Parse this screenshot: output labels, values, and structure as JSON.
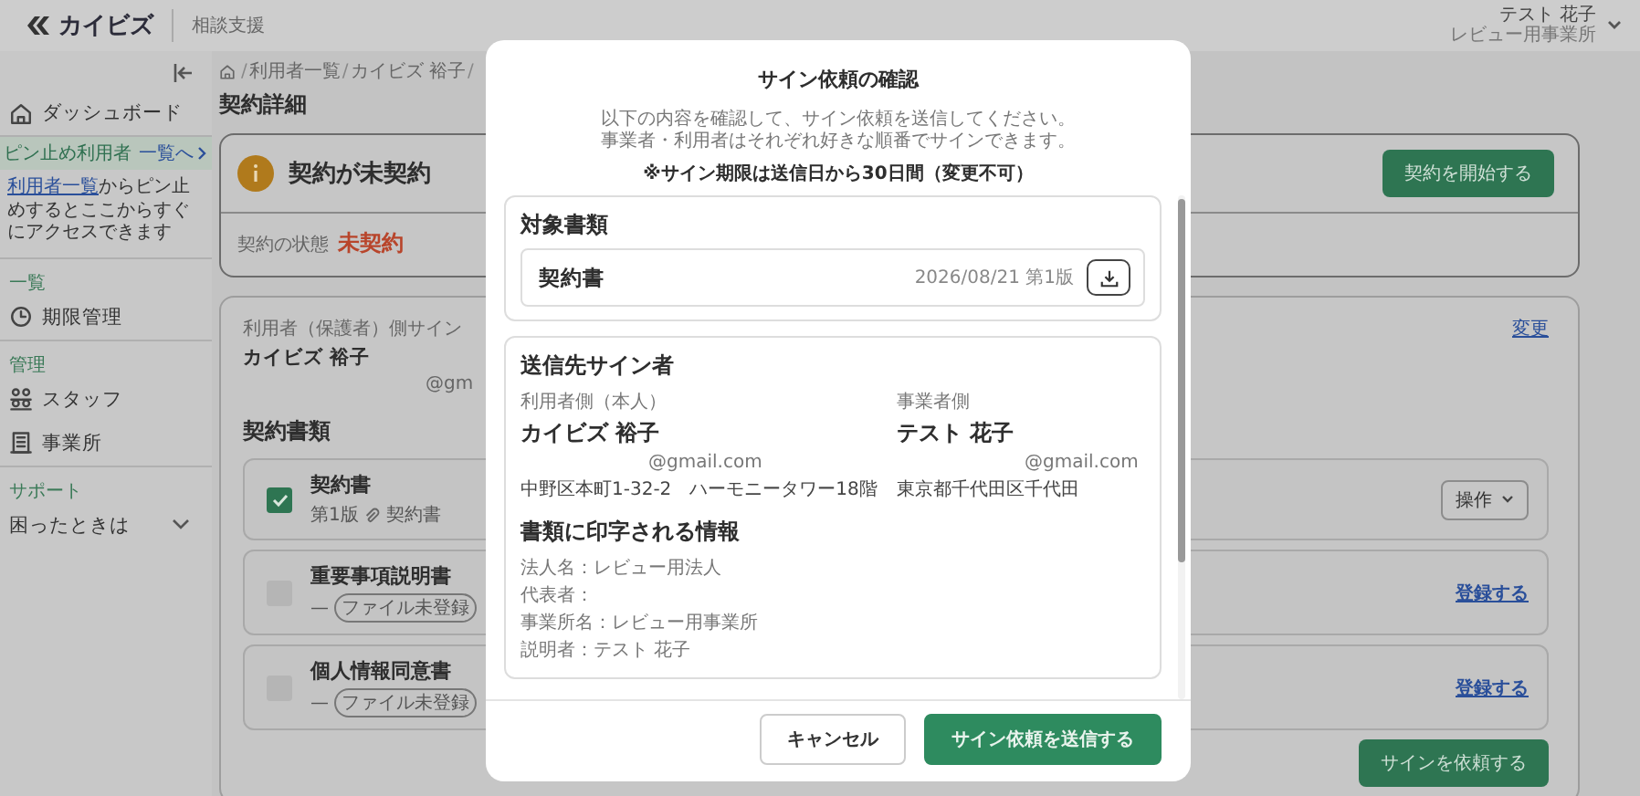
{
  "header": {
    "logo": "カイビズ",
    "product": "相談支援",
    "user_name": "テスト 花子",
    "user_office": "レビュー用事業所"
  },
  "sidebar": {
    "items": [
      {
        "kind": "nav",
        "label": "ダッシュボード"
      },
      {
        "kind": "pin_header",
        "label": "ピン止め利用者",
        "link": "一覧へ"
      },
      {
        "kind": "pin_hint",
        "link": "利用者一覧",
        "text": "からピン止めするとここからすぐにアクセスできます"
      },
      {
        "kind": "section",
        "label": "一覧"
      },
      {
        "kind": "nav",
        "label": "期限管理"
      },
      {
        "kind": "section",
        "label": "管理"
      },
      {
        "kind": "nav",
        "label": "スタッフ"
      },
      {
        "kind": "nav",
        "label": "事業所"
      },
      {
        "kind": "section",
        "label": "サポート"
      },
      {
        "kind": "expandable",
        "label": "困ったときは",
        "expanded": false
      }
    ]
  },
  "main": {
    "breadcrumb": {
      "separator": "/",
      "items": [
        "利用者一覧",
        "カイビズ 裕子"
      ]
    },
    "title": "契約詳細",
    "alert": {
      "title": "契約が未契約",
      "button": "契約を開始する",
      "status_label": "契約の状態",
      "status_value": "未契約"
    },
    "signer": {
      "label": "利用者（保護者）側サイン",
      "name": "カイビズ 裕子",
      "email": "@gm",
      "change_link": "変更"
    },
    "documents": {
      "heading": "契約書類",
      "items": [
        {
          "kind": "registered",
          "checked": true,
          "name": "契約書",
          "version": "第1版",
          "file": "契約書",
          "action": "操作"
        },
        {
          "kind": "unregistered",
          "checked": false,
          "name": "重要事項説明書",
          "dash": "—",
          "tag": "ファイル未登録",
          "action": "登録する"
        },
        {
          "kind": "unregistered",
          "checked": false,
          "name": "個人情報同意書",
          "dash": "—",
          "tag": "ファイル未登録",
          "action": "登録する"
        }
      ],
      "button": "サインを依頼する"
    }
  },
  "dialog": {
    "title": "サイン依頼の確認",
    "description": [
      "以下の内容を確認して、サイン依頼を送信してください。",
      "事業者・利用者はそれぞれ好きな順番でサインできます。"
    ],
    "note": "※サイン期限は送信日から30日間（変更不可）",
    "documents": {
      "heading": "対象書類",
      "items": [
        {
          "name": "契約書",
          "meta": "2026/08/21 第1版"
        }
      ]
    },
    "signers": {
      "heading": "送信先サイン者",
      "parties": [
        {
          "role": "利用者側（本人）",
          "name": "カイビズ 裕子",
          "email": "@gmail.com",
          "address": "中野区本町1-32-2　ハーモニータワー18階"
        },
        {
          "role": "事業者側",
          "name": "テスト 花子",
          "email": "@gmail.com",
          "address": "東京都千代田区千代田"
        }
      ]
    },
    "printed_info": {
      "heading": "書類に印字される情報",
      "lines": [
        "法人名：レビュー用法人",
        "代表者：",
        "事業所名：レビュー用事業所",
        "説明者：テスト 花子"
      ]
    },
    "buttons": [
      {
        "kind": "secondary",
        "label": "キャンセル"
      },
      {
        "kind": "primary",
        "label": "サイン依頼を送信する"
      }
    ]
  }
}
